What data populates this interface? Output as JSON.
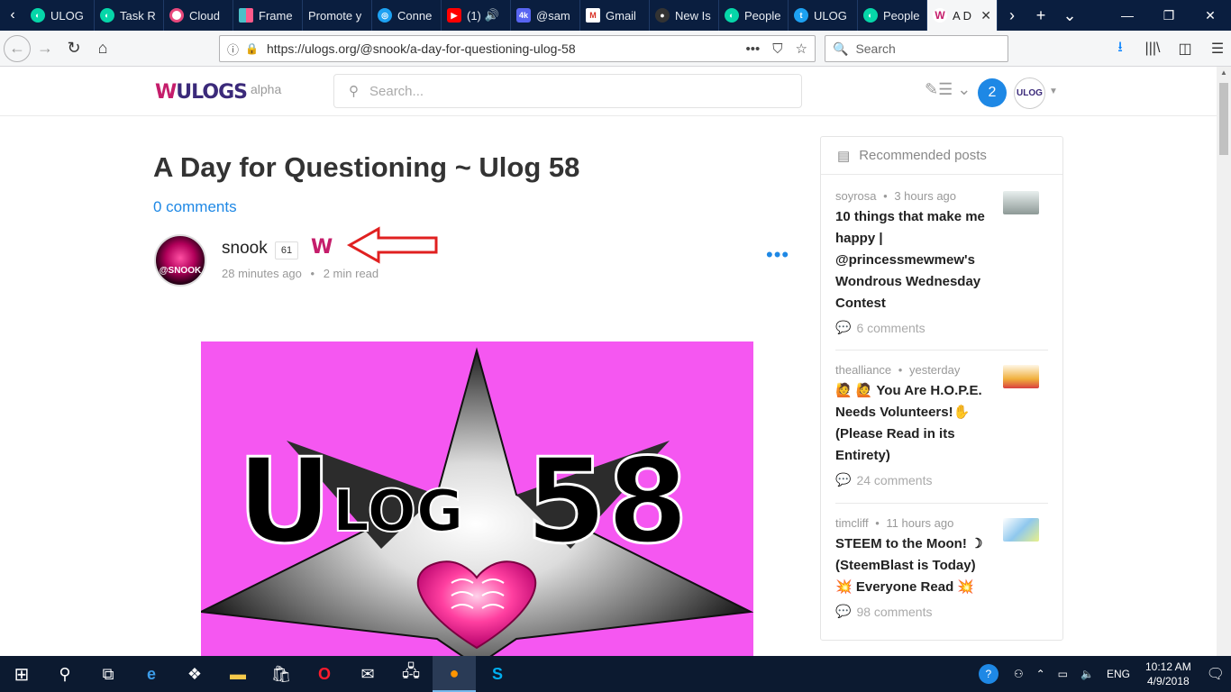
{
  "browser": {
    "tabs": [
      {
        "label": "ULOG",
        "icon": "steemit-icon",
        "color": "#06d6a9"
      },
      {
        "label": "Task R",
        "icon": "steemit-icon",
        "color": "#06d6a9"
      },
      {
        "label": "Cloud",
        "icon": "cloud-icon",
        "color": "#e8487c"
      },
      {
        "label": "Frame",
        "icon": "frame-icon",
        "color": "#4bc0c8"
      },
      {
        "label": "Promote y",
        "icon": "",
        "color": ""
      },
      {
        "label": "Conne",
        "icon": "connect-icon",
        "color": "#1da1f2"
      },
      {
        "label": "(1)",
        "icon": "youtube-icon",
        "color": "#ff0000"
      },
      {
        "label": "@sam",
        "icon": "discord-icon",
        "color": "#5865f2"
      },
      {
        "label": "Gmail",
        "icon": "gmail-icon",
        "color": "#d93025"
      },
      {
        "label": "New Is",
        "icon": "github-icon",
        "color": "#333333"
      },
      {
        "label": "People",
        "icon": "steemit-icon",
        "color": "#06d6a9"
      },
      {
        "label": "ULOG",
        "icon": "twitter-icon",
        "color": "#1da1f2"
      },
      {
        "label": "People",
        "icon": "steemit-icon",
        "color": "#06d6a9"
      },
      {
        "label": "A D",
        "icon": "ulog-icon",
        "color": "#c51d6b"
      }
    ],
    "url": "https://ulogs.org/@snook/a-day-for-questioning-ulog-58",
    "search_placeholder": "Search"
  },
  "site": {
    "logo_text": "ULOGS",
    "logo_suffix": "alpha",
    "search_placeholder": "Search...",
    "notifications": "2"
  },
  "post": {
    "title": "A Day for Questioning ~ Ulog 58",
    "comments_link": "0 comments",
    "author": "snook",
    "reputation": "61",
    "avatar_text": "@SNOOK",
    "time": "28 minutes ago",
    "read_time": "2 min read",
    "hero_text_big": "U",
    "hero_text_log": "LOG",
    "hero_text_num": "58"
  },
  "sidebar": {
    "heading": "Recommended posts",
    "items": [
      {
        "author": "soyrosa",
        "time": "3 hours ago",
        "title": "10 things that make me happy | @princessmewmew's Wondrous Wednesday Contest",
        "comments": "6 comments",
        "thumb_color": "#9ea9a6"
      },
      {
        "author": "thealliance",
        "time": "yesterday",
        "title": "🙋 🙋 You Are H.O.P.E. Needs Volunteers!✋ (Please Read in its Entirety)",
        "comments": "24 comments",
        "thumb_color": "#f1e4c8"
      },
      {
        "author": "timcliff",
        "time": "11 hours ago",
        "title": "STEEM to the Moon! ☽ (SteemBlast is Today) 💥 Everyone Read 💥",
        "comments": "98 comments",
        "thumb_color": "#a9d3ee"
      }
    ]
  },
  "taskbar": {
    "language": "ENG",
    "time": "10:12 AM",
    "date": "4/9/2018"
  },
  "colors": {
    "accent": "#1e88e5",
    "hero_bg": "#f557f1",
    "arrow": "#e02020"
  }
}
